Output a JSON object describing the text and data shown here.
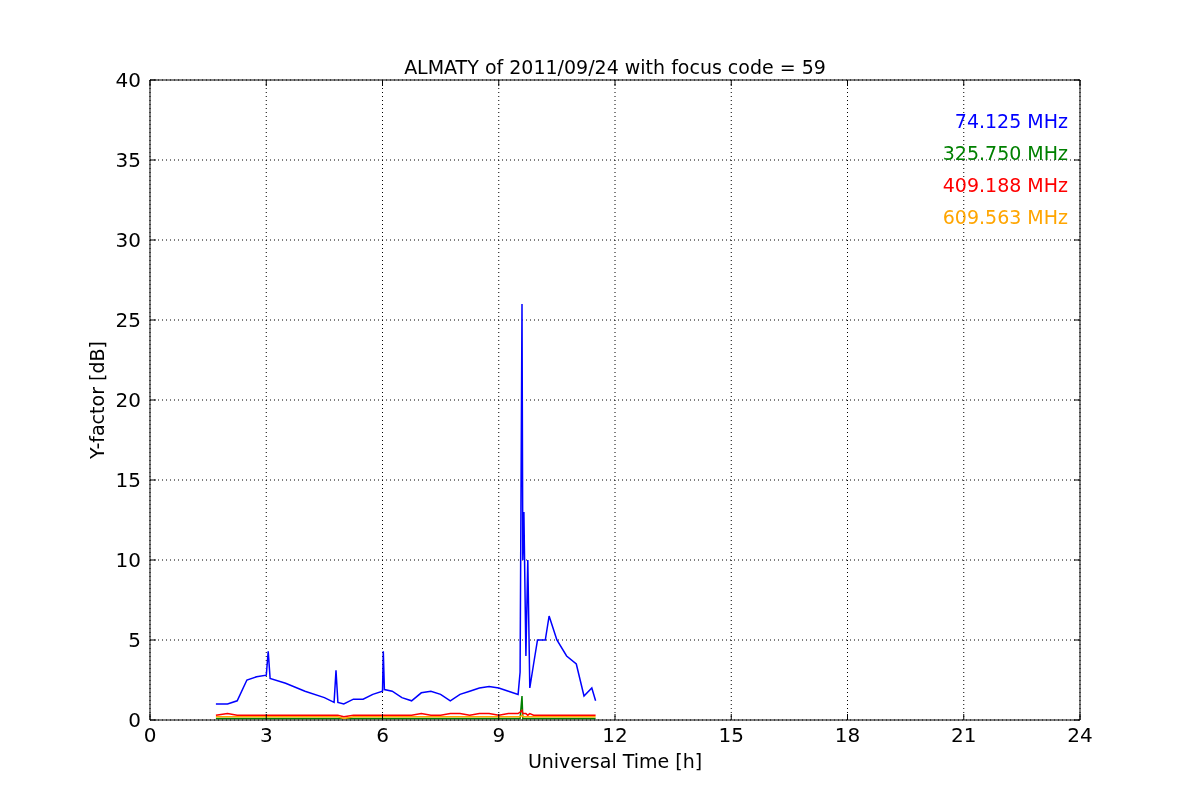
{
  "chart_data": {
    "type": "line",
    "title": "ALMATY of 2011/09/24 with focus code = 59",
    "xlabel": "Universal Time [h]",
    "ylabel": "Y-factor [dB]",
    "x": [
      1.7,
      2.0,
      2.25,
      2.5,
      2.75,
      3.0,
      3.05,
      3.1,
      3.5,
      4.0,
      4.5,
      4.75,
      4.8,
      4.85,
      5.0,
      5.25,
      5.5,
      5.75,
      6.0,
      6.02,
      6.05,
      6.25,
      6.5,
      6.75,
      7.0,
      7.25,
      7.5,
      7.75,
      8.0,
      8.25,
      8.5,
      8.75,
      9.0,
      9.25,
      9.5,
      9.55,
      9.6,
      9.62,
      9.65,
      9.7,
      9.75,
      9.8,
      9.9,
      10.0,
      10.2,
      10.3,
      10.5,
      10.75,
      11.0,
      11.2,
      11.4,
      11.5
    ],
    "series": [
      {
        "name": "74.125 MHz",
        "color": "#0000ff",
        "values": [
          1.0,
          1.0,
          1.2,
          2.5,
          2.7,
          2.8,
          4.3,
          2.6,
          2.3,
          1.8,
          1.4,
          1.1,
          3.1,
          1.1,
          1.0,
          1.3,
          1.3,
          1.6,
          1.8,
          4.3,
          1.9,
          1.8,
          1.4,
          1.2,
          1.7,
          1.8,
          1.6,
          1.2,
          1.6,
          1.8,
          2.0,
          2.1,
          2.0,
          1.8,
          1.6,
          3.0,
          26.0,
          10.0,
          13.0,
          4.0,
          10.0,
          2.0,
          3.5,
          5.0,
          5.0,
          6.5,
          5.0,
          4.0,
          3.5,
          1.5,
          2.0,
          1.2
        ]
      },
      {
        "name": "325.750 MHz",
        "color": "#008000",
        "values": [
          0.1,
          0.1,
          0.1,
          0.1,
          0.1,
          0.1,
          0.1,
          0.1,
          0.1,
          0.1,
          0.1,
          0.1,
          0.1,
          0.1,
          0.1,
          0.1,
          0.1,
          0.1,
          0.1,
          0.1,
          0.1,
          0.1,
          0.1,
          0.1,
          0.1,
          0.1,
          0.1,
          0.1,
          0.1,
          0.1,
          0.1,
          0.1,
          0.1,
          0.1,
          0.1,
          0.1,
          1.5,
          0.1,
          0.1,
          0.1,
          0.1,
          0.1,
          0.1,
          0.1,
          0.1,
          0.1,
          0.1,
          0.1,
          0.1,
          0.1,
          0.1,
          0.1
        ]
      },
      {
        "name": "409.188 MHz",
        "color": "#ff0000",
        "values": [
          0.3,
          0.4,
          0.3,
          0.3,
          0.3,
          0.3,
          0.3,
          0.3,
          0.3,
          0.3,
          0.3,
          0.3,
          0.3,
          0.3,
          0.2,
          0.3,
          0.3,
          0.3,
          0.3,
          0.3,
          0.3,
          0.3,
          0.3,
          0.3,
          0.4,
          0.3,
          0.3,
          0.4,
          0.4,
          0.3,
          0.4,
          0.4,
          0.3,
          0.4,
          0.4,
          0.5,
          0.6,
          0.4,
          0.4,
          0.4,
          0.3,
          0.4,
          0.3,
          0.3,
          0.3,
          0.3,
          0.3,
          0.3,
          0.3,
          0.3,
          0.3,
          0.3
        ]
      },
      {
        "name": "609.563 MHz",
        "color": "#ffa500",
        "values": [
          0.2,
          0.2,
          0.2,
          0.2,
          0.2,
          0.2,
          0.2,
          0.2,
          0.2,
          0.2,
          0.2,
          0.2,
          0.2,
          0.2,
          0.1,
          0.2,
          0.2,
          0.2,
          0.2,
          0.2,
          0.2,
          0.2,
          0.2,
          0.2,
          0.2,
          0.2,
          0.2,
          0.2,
          0.2,
          0.2,
          0.2,
          0.2,
          0.2,
          0.2,
          0.2,
          0.2,
          0.3,
          0.2,
          0.2,
          0.2,
          0.2,
          0.2,
          0.2,
          0.2,
          0.2,
          0.2,
          0.2,
          0.2,
          0.2,
          0.2,
          0.2,
          0.2
        ]
      }
    ],
    "xlim": [
      0,
      24
    ],
    "ylim": [
      0,
      40
    ],
    "xticks": [
      0,
      3,
      6,
      9,
      12,
      15,
      18,
      21,
      24
    ],
    "yticks": [
      0,
      5,
      10,
      15,
      20,
      25,
      30,
      35,
      40
    ],
    "grid": true
  }
}
